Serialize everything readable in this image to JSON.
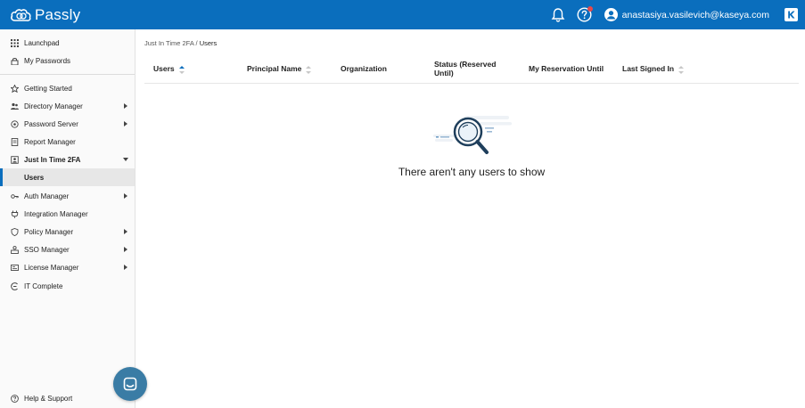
{
  "header": {
    "brand_name": "Passly",
    "user_email": "anastasiya.vasilevich@kaseya.com",
    "icons": [
      "passly-logo-icon",
      "bell-icon",
      "help-icon",
      "user-icon",
      "kaseya-logo-icon"
    ],
    "accent_color": "#0a6ebd"
  },
  "sidebar": {
    "top_items": [
      {
        "label": "Launchpad",
        "icon": "grid-icon"
      },
      {
        "label": "My Passwords",
        "icon": "lock-icon"
      }
    ],
    "items": [
      {
        "label": "Getting Started",
        "icon": "star-icon"
      },
      {
        "label": "Directory Manager",
        "icon": "users-icon"
      },
      {
        "label": "Password Server",
        "icon": "server-icon"
      },
      {
        "label": "Report Manager",
        "icon": "report-icon"
      },
      {
        "label": "Just In Time 2FA",
        "icon": "jit-icon"
      },
      {
        "label": "Users"
      },
      {
        "label": "Auth Manager",
        "icon": "key-icon"
      },
      {
        "label": "Integration Manager",
        "icon": "plug-icon"
      },
      {
        "label": "Policy Manager",
        "icon": "shield-icon"
      },
      {
        "label": "SSO Manager",
        "icon": "sso-icon"
      },
      {
        "label": "License Manager",
        "icon": "license-icon"
      },
      {
        "label": "IT Complete",
        "icon": "it-complete-icon"
      }
    ],
    "help_label": "Help & Support"
  },
  "main": {
    "breadcrumb_parent": "Just In Time 2FA",
    "breadcrumb_sep": " / ",
    "breadcrumb_current": "Users",
    "columns": [
      "Users",
      "Principal Name",
      "Organization",
      "Status (Reserved Until)",
      "My Reservation Until",
      "Last Signed In"
    ],
    "empty_message": "There aren't any users to show"
  }
}
